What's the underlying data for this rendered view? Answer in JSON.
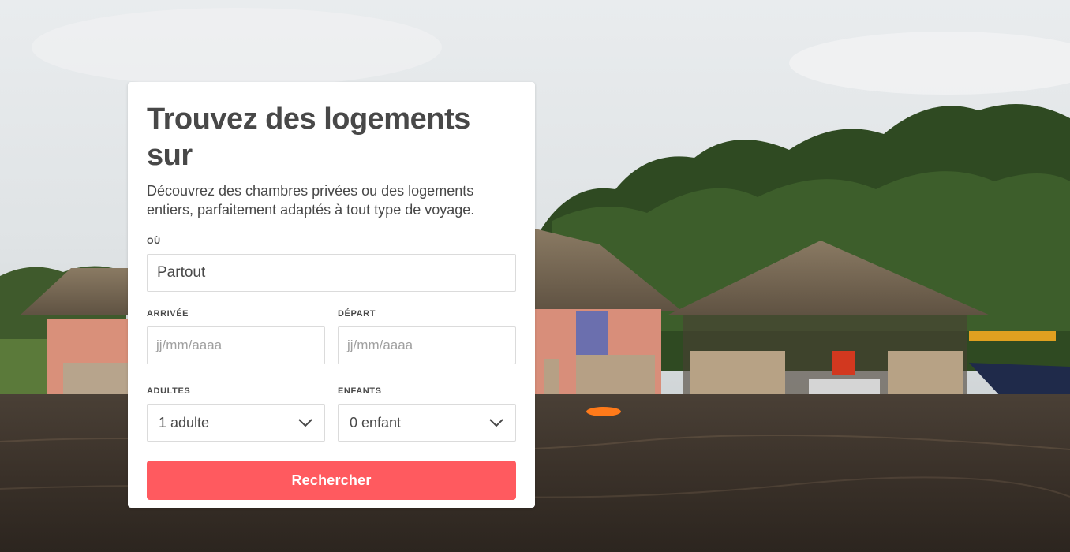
{
  "colors": {
    "accent": "#ff5a5f",
    "text": "#484848",
    "placeholder": "#a0a0a0",
    "border": "#dbdbdb"
  },
  "search_card": {
    "title": "Trouvez des logements sur",
    "subtitle": "Découvrez des chambres privées ou des logements entiers, parfaitement adaptés à tout type de voyage.",
    "where": {
      "label": "Où",
      "value": "Partout"
    },
    "checkin": {
      "label": "Arrivée",
      "placeholder": "jj/mm/aaaa"
    },
    "checkout": {
      "label": "Départ",
      "placeholder": "jj/mm/aaaa"
    },
    "adults": {
      "label": "Adultes",
      "value": "1 adulte",
      "icon": "chevron-down-icon"
    },
    "children": {
      "label": "Enfants",
      "value": "0 enfant",
      "icon": "chevron-down-icon"
    },
    "search_button": "Rechercher"
  }
}
